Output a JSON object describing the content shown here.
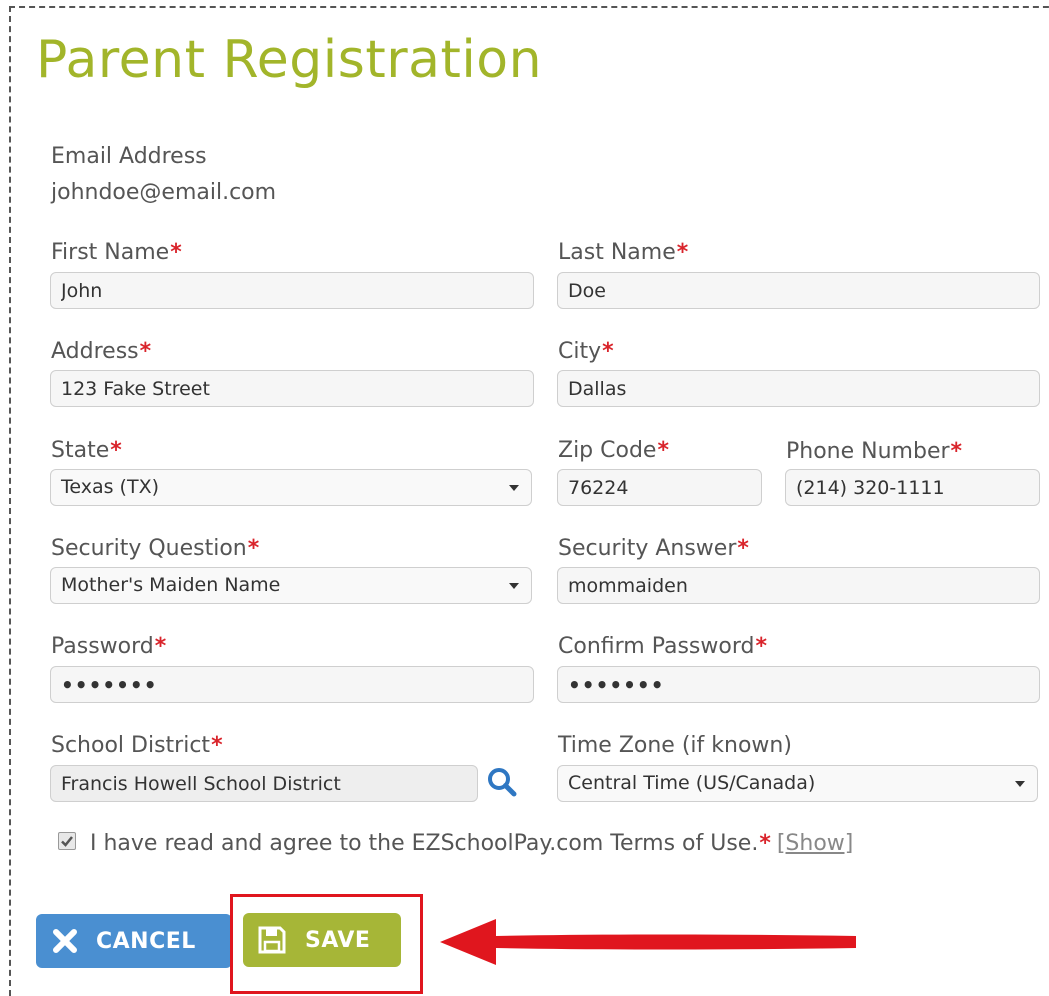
{
  "page": {
    "title": "Parent Registration"
  },
  "form": {
    "email": {
      "label": "Email Address",
      "value": "johndoe@email.com"
    },
    "first_name": {
      "label": "First Name",
      "required": "*",
      "value": "John"
    },
    "last_name": {
      "label": "Last Name",
      "required": "*",
      "value": "Doe"
    },
    "address": {
      "label": "Address",
      "required": "*",
      "value": "123 Fake Street"
    },
    "city": {
      "label": "City",
      "required": "*",
      "value": "Dallas"
    },
    "state": {
      "label": "State",
      "required": "*",
      "value": "Texas (TX)"
    },
    "zip": {
      "label": "Zip Code",
      "required": "*",
      "value": "76224"
    },
    "phone": {
      "label": "Phone Number",
      "required": "*",
      "value": "(214) 320-1111"
    },
    "security_question": {
      "label": "Security Question",
      "required": "*",
      "value": "Mother's Maiden Name"
    },
    "security_answer": {
      "label": "Security Answer",
      "required": "*",
      "value": "mommaiden"
    },
    "password": {
      "label": "Password",
      "required": "*",
      "value": "•••••••"
    },
    "confirm_password": {
      "label": "Confirm Password",
      "required": "*",
      "value": "•••••••"
    },
    "school_district": {
      "label": "School District",
      "required": "*",
      "value": "Francis Howell School District"
    },
    "time_zone": {
      "label": "Time Zone (if known)",
      "value": "Central Time (US/Canada)"
    },
    "terms": {
      "checked": true,
      "text": "I have read and agree to the EZSchoolPay.com Terms of Use.",
      "required": "*",
      "show_link": "[Show]"
    }
  },
  "buttons": {
    "cancel_label": "CANCEL",
    "save_label": "SAVE"
  },
  "icons": {
    "search": "search-icon",
    "close": "close-icon",
    "save": "floppy-disk-icon",
    "check": "check-icon"
  },
  "colors": {
    "title": "#a2b52a",
    "required": "#d9242b",
    "cancel_button": "#4a8fd1",
    "save_button": "#a6b637",
    "annotation": "#e0161e"
  }
}
